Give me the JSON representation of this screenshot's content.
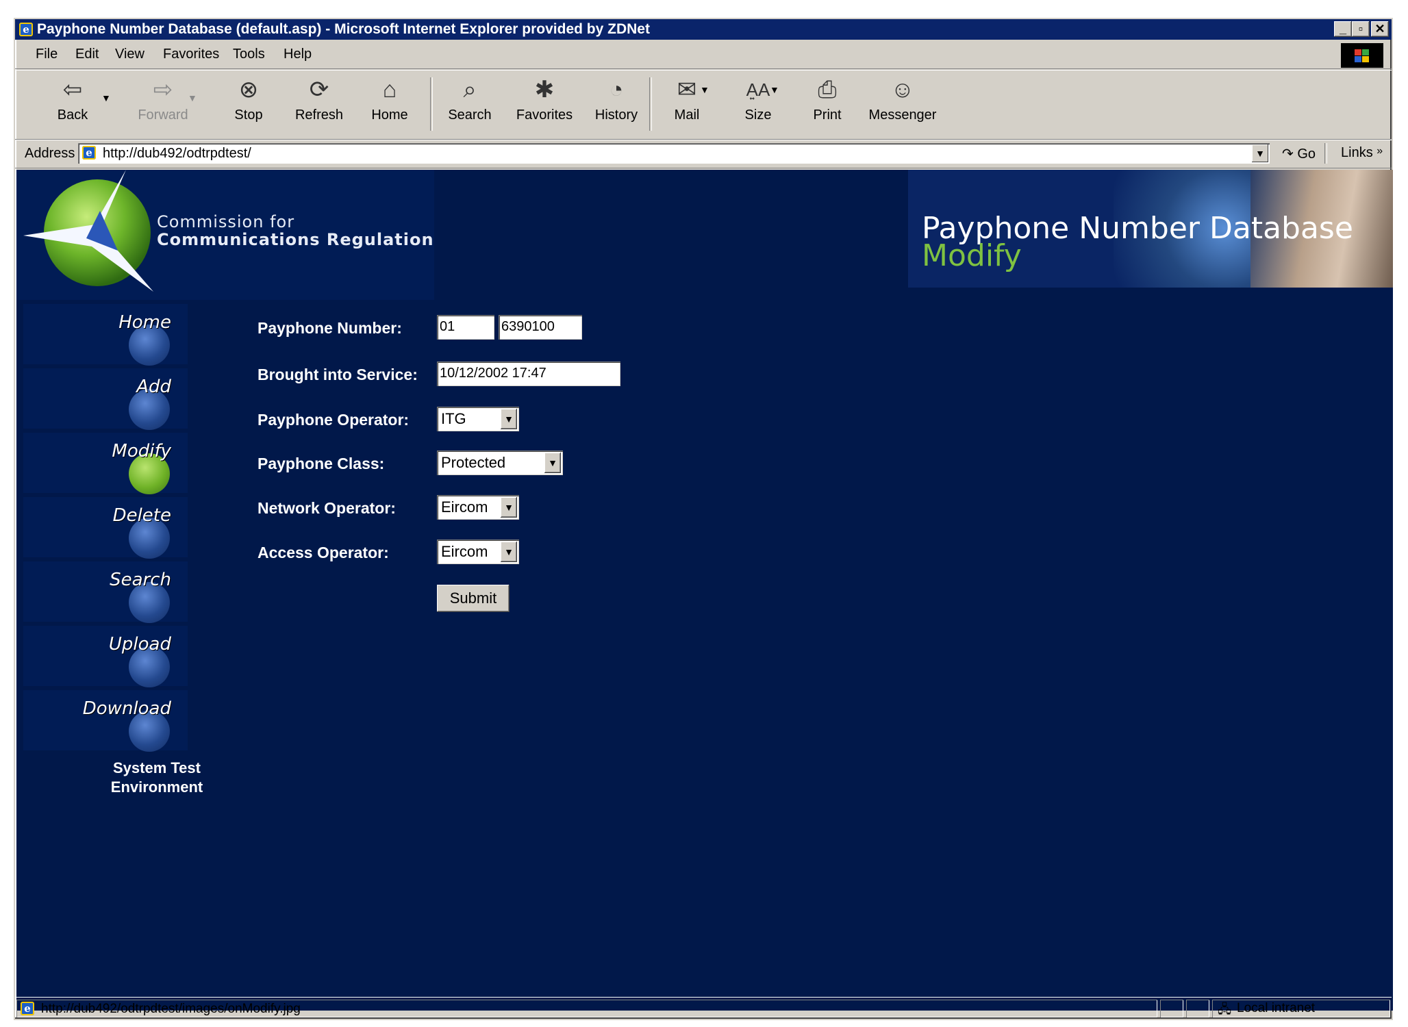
{
  "window": {
    "title": "Payphone Number Database (default.asp) - Microsoft Internet Explorer provided by ZDNet",
    "controls": [
      "_",
      "▫",
      "✕"
    ]
  },
  "menu": [
    "File",
    "Edit",
    "View",
    "Favorites",
    "Tools",
    "Help"
  ],
  "toolbar": {
    "back": "Back",
    "forward": "Forward",
    "stop": "Stop",
    "refresh": "Refresh",
    "home": "Home",
    "search": "Search",
    "favorites": "Favorites",
    "history": "History",
    "mail": "Mail",
    "size": "Size",
    "print": "Print",
    "messenger": "Messenger"
  },
  "address": {
    "label": "Address",
    "url": "http://dub492/odtrpdtest/",
    "go": "Go",
    "links": "Links"
  },
  "header": {
    "org_line1": "Commission for",
    "org_line2": "Communications Regulation",
    "app_title": "Payphone Number Database",
    "page_title": "Modify"
  },
  "nav": [
    {
      "label": "Home",
      "active": false
    },
    {
      "label": "Add",
      "active": false
    },
    {
      "label": "Modify",
      "active": true
    },
    {
      "label": "Delete",
      "active": false
    },
    {
      "label": "Search",
      "active": false
    },
    {
      "label": "Upload",
      "active": false
    },
    {
      "label": "Download",
      "active": false
    }
  ],
  "environment": {
    "line1": "System Test",
    "line2": "Environment"
  },
  "form": {
    "payphone_number_label": "Payphone Number:",
    "area_code": "01",
    "number": "6390100",
    "service_label": "Brought into Service:",
    "service_date": "10/12/2002 17:47",
    "operator_label": "Payphone Operator:",
    "operator_value": "ITG",
    "class_label": "Payphone Class:",
    "class_value": "Protected",
    "network_label": "Network Operator:",
    "network_value": "Eircom",
    "access_label": "Access Operator:",
    "access_value": "Eircom",
    "submit_label": "Submit"
  },
  "status": {
    "text": "http://dub492/odtrpdtest/images/onModify.jpg",
    "zone": "Local intranet"
  },
  "icons": {
    "page_icon": "ie-page-icon",
    "back": "back-arrow-icon",
    "forward": "forward-arrow-icon",
    "stop": "stop-icon",
    "refresh": "refresh-icon",
    "home": "home-icon",
    "search": "search-icon",
    "favorites": "favorites-icon",
    "history": "history-icon",
    "mail": "mail-icon",
    "size": "font-size-icon",
    "print": "print-icon",
    "messenger": "messenger-icon"
  },
  "colors": {
    "page_bg": "#01184a",
    "accent_green": "#7fc241",
    "titlebar": "#0a246a",
    "chrome": "#d4d0c8"
  }
}
